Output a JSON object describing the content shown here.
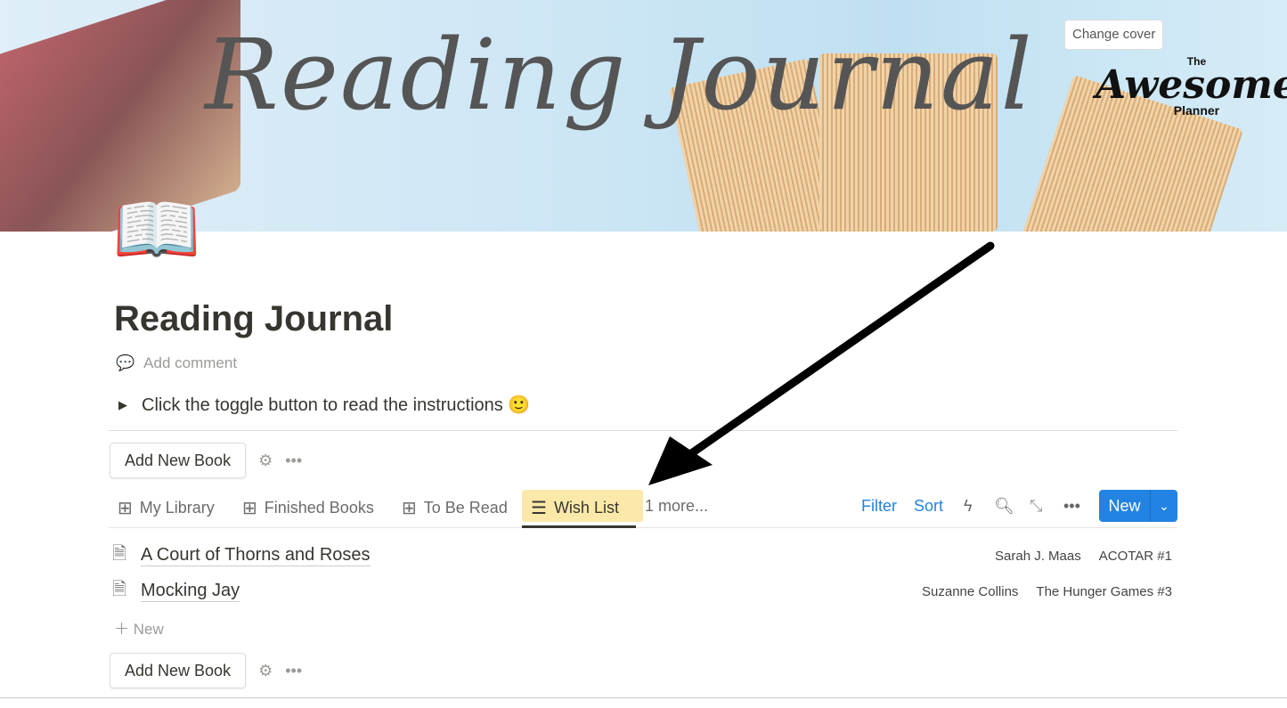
{
  "cover": {
    "script_title": "Reading Journal",
    "logo": "The Awesome Planner",
    "logo_the": "The",
    "logo_awesome": "Awesome",
    "logo_planner": "Planner",
    "change_cover": "Change cover"
  },
  "page": {
    "icon": "📖",
    "title": "Reading Journal",
    "add_comment": "Add comment",
    "toggle_text": "Click the toggle button to read the instructions 🙂"
  },
  "buttons": {
    "add_new_book": "Add New Book"
  },
  "tabs": [
    {
      "label": "My Library",
      "icon": "grid-icon"
    },
    {
      "label": "Finished Books",
      "icon": "grid-icon"
    },
    {
      "label": "To Be Read",
      "icon": "grid-icon"
    },
    {
      "label": "Wish List",
      "icon": "list-icon",
      "active": true
    }
  ],
  "more_tabs": "1 more...",
  "actions": {
    "filter": "Filter",
    "sort": "Sort",
    "new": "New"
  },
  "rows": [
    {
      "title": "A Court of Thorns and Roses",
      "author": "Sarah J. Maas",
      "series": "ACOTAR #1"
    },
    {
      "title": "Mocking Jay",
      "author": "Suzanne Collins",
      "series": "The Hunger Games #3"
    }
  ],
  "add_row": "New",
  "colors": {
    "accent": "#2383e2",
    "highlight": "#fbe59a"
  }
}
